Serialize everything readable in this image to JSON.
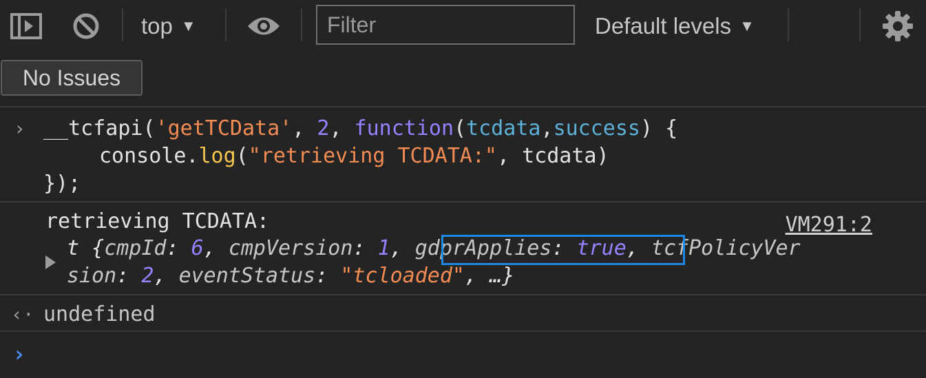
{
  "toolbar": {
    "context_label": "top",
    "filter_placeholder": "Filter",
    "levels_label": "Default levels"
  },
  "issues": {
    "label": "No Issues"
  },
  "console": {
    "command": {
      "line1": {
        "fn": "__tcfapi(",
        "arg1": "'getTCData'",
        "comma1": ", ",
        "arg2": "2",
        "comma2": ", ",
        "kw": "function",
        "open": "(",
        "p1": "tcdata",
        "comma3": ",",
        "p2": "success",
        "close": ") {"
      },
      "line2": {
        "obj": "console.",
        "method": "log",
        "open": "(",
        "str": "\"retrieving TCDATA:\"",
        "rest": ", tcdata)"
      },
      "line3": "});"
    },
    "log": {
      "message": "retrieving TCDATA:",
      "source_link": "VM291:2",
      "object": {
        "prefix": "t {",
        "k1": "cmpId",
        "v1": "6",
        "k2": "cmpVersion",
        "v2": "1",
        "k3": "gdprApplies",
        "v3": "true",
        "k4_part1": "tcfPolicyVer",
        "k4_part2": "sion",
        "v4": "2",
        "k5": "eventStatus",
        "v5": "\"tcloaded\"",
        "suffix": ", …}"
      }
    },
    "result": "undefined"
  },
  "colors": {
    "background": "#242424",
    "highlight_box": "#1e88e5",
    "string": "#f28b54",
    "number": "#9980ff",
    "param": "#5db0d7",
    "method": "#f5c74e",
    "prompt_caret": "#4a8bf5"
  },
  "icons": [
    "sidebar-toggle-icon",
    "clear-console-icon",
    "eye-icon",
    "gear-icon",
    "chevron-right-icon",
    "result-arrow-icon",
    "expand-triangle-icon"
  ]
}
